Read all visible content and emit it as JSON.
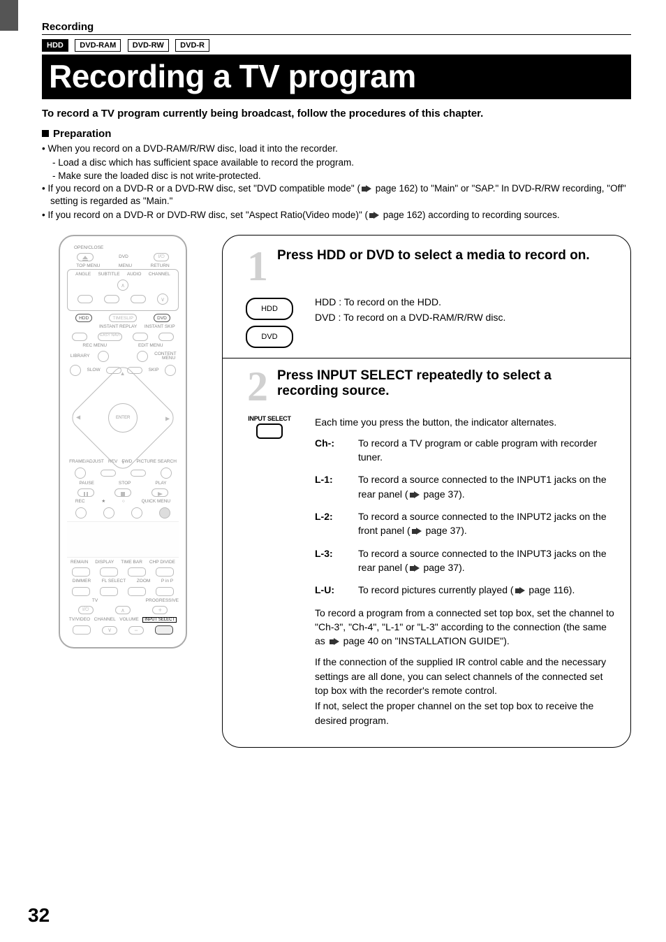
{
  "header": {
    "section": "Recording",
    "badges": [
      "HDD",
      "DVD-RAM",
      "DVD-RW",
      "DVD-R"
    ],
    "title": "Recording a TV program",
    "lead": "To record a TV program currently being broadcast, follow the procedures of this chapter."
  },
  "preparation": {
    "heading": "Preparation",
    "b1": "When you record on a DVD-RAM/R/RW disc, load it into the recorder.",
    "b1a": "- Load a disc which has sufficient space available to record the program.",
    "b1b": "- Make sure the loaded disc is not write-protected.",
    "b2a": "If you record on a DVD-R or a DVD-RW disc, set \"DVD compatible mode\" (",
    "b2b": " page 162) to \"Main\" or \"SAP.\" In DVD-R/RW recording, \"Off\" setting is regarded as \"Main.\"",
    "b3a": "If you record on a DVD-R or DVD-RW disc, set \"Aspect Ratio(Video mode)\" (",
    "b3b": " page 162) according to recording sources."
  },
  "remote": {
    "top": {
      "open_close": "OPEN/CLOSE",
      "power_group": "DVD",
      "top_menu": "TOP MENU",
      "menu": "MENU",
      "return": "RETURN",
      "angle": "ANGLE",
      "subtitle": "SUBTITLE",
      "audio": "AUDIO",
      "channel": "CHANNEL",
      "hdd": "HDD",
      "timeslip": "TIMESLIP",
      "dvd": "DVD",
      "inst_replay": "INSTANT REPLAY",
      "inst_skip": "INSTANT SKIP",
      "easy_navi": "EASY NAVI",
      "rec_menu": "REC MENU",
      "edit_menu": "EDIT MENU",
      "library": "LIBRARY",
      "content_menu": "CONTENT MENU",
      "slow": "SLOW",
      "skip": "SKIP",
      "enter": "ENTER",
      "frame_adjust": "FRAME/ADJUST",
      "picture_search": "PICTURE SEARCH",
      "rev": "REV",
      "fwd": "FWD",
      "pause": "PAUSE",
      "stop": "STOP",
      "play": "PLAY",
      "rec": "REC",
      "quick_menu": "QUICK MENU"
    },
    "bottom": {
      "remain": "REMAIN",
      "display": "DISPLAY",
      "time_bar": "TIME BAR",
      "chp_divide": "CHP DIVIDE",
      "dimmer": "DIMMER",
      "fl_select": "FL SELECT",
      "zoom": "ZOOM",
      "pinp": "P in P",
      "tv": "TV",
      "progressive": "PROGRESSIVE",
      "tv_video": "TV/VIDEO",
      "channel": "CHANNEL",
      "volume": "VOLUME",
      "input_select": "INPUT SELECT"
    }
  },
  "steps": {
    "s1": {
      "num": "1",
      "head": "Press HDD or DVD to select a media to record on.",
      "hdd_key": "HDD",
      "dvd_key": "DVD",
      "desc_hdd": "HDD : To record on the HDD.",
      "desc_dvd": "DVD : To record on a DVD-RAM/R/RW disc."
    },
    "s2": {
      "num": "2",
      "head": "Press INPUT SELECT repeatedly to select a recording source.",
      "key_caption": "INPUT SELECT",
      "intro": "Each time you press the button, the indicator alternates.",
      "items": {
        "ch": {
          "term": "Ch-:",
          "def": "To record a TV program or cable program with recorder tuner."
        },
        "l1": {
          "term": "L-1:",
          "def_a": "To record a source connected to the INPUT1 jacks on the rear panel (",
          "def_b": " page 37)."
        },
        "l2": {
          "term": "L-2:",
          "def_a": "To record a source connected to the INPUT2 jacks on the front panel (",
          "def_b": " page 37)."
        },
        "l3": {
          "term": "L-3:",
          "def_a": "To record a source connected to the INPUT3 jacks on the rear panel (",
          "def_b": " page 37)."
        },
        "lu": {
          "term": "L-U:",
          "def_a": "To record pictures currently played (",
          "def_b": " page 116)."
        }
      },
      "note1a": "To record a program from a connected set top box, set the channel to \"Ch-3\", \"Ch-4\", \"L-1\" or \"L-3\" according to the connection (the same as ",
      "note1b": " page 40 on \"INSTALLATION GUIDE\").",
      "note2": "If the connection of the supplied IR control cable and the necessary settings are all done, you can select channels of the connected set top box with the recorder's remote control.",
      "note3": "If not, select the proper channel on the set top box to receive the desired program."
    }
  },
  "page_number": "32"
}
